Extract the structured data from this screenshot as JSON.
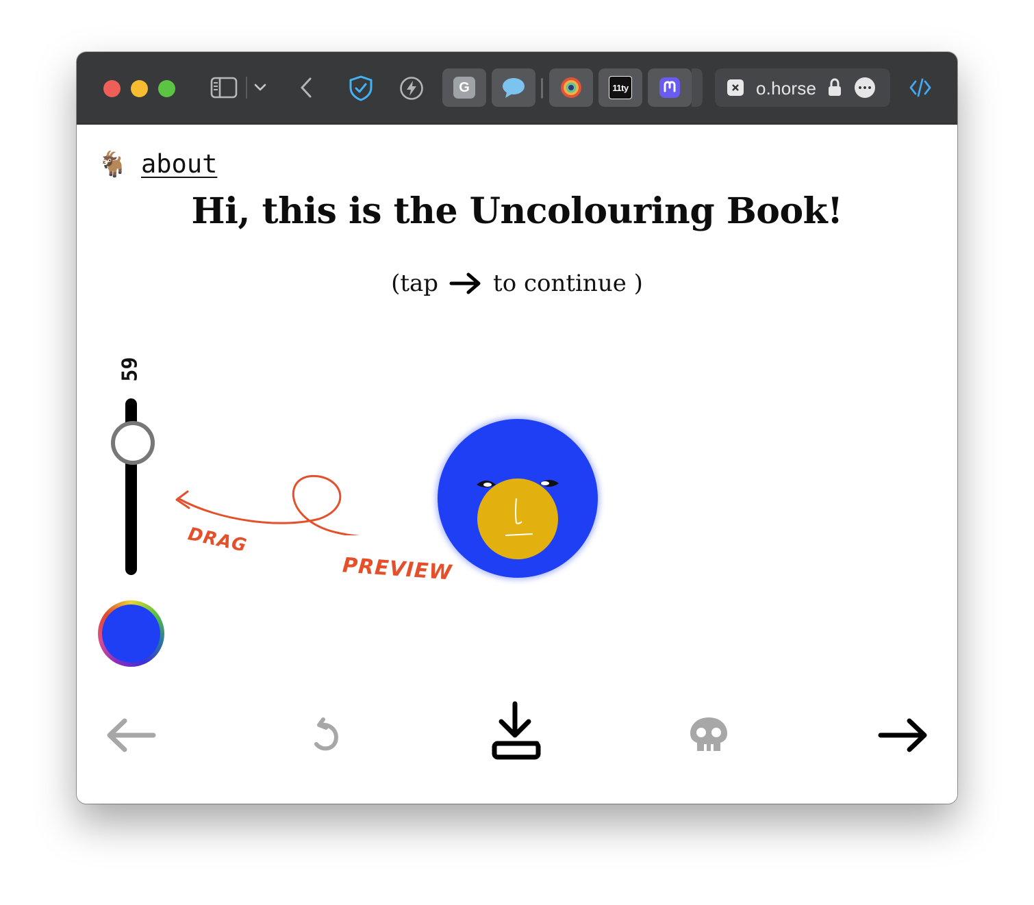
{
  "browser": {
    "url_text": "o.horse",
    "tabs": [
      {
        "name": "tab-g",
        "label": "G"
      },
      {
        "name": "tab-chat",
        "label": ""
      },
      {
        "name": "tab-circle",
        "label": ""
      },
      {
        "name": "tab-11ty",
        "label": "11ty"
      },
      {
        "name": "tab-mastodon",
        "label": ""
      }
    ],
    "icons": [
      "sidebar-icon",
      "chevron-down-icon",
      "back-icon",
      "shield-check-icon",
      "lightning-icon",
      "close-tab-icon",
      "lock-icon",
      "more-icon",
      "code-icon"
    ]
  },
  "page": {
    "logo_emoji": "🐐",
    "about_link": "about",
    "title": "Hi, this is the Uncolouring Book!",
    "hint_before": "(tap",
    "hint_after": "to continue )",
    "slider_value": "59",
    "annotation_drag": "DRAG",
    "annotation_preview": "PREVIEW",
    "color_hex": "#1f3ff5",
    "face_color": "#e2b10f"
  },
  "bottom_toolbar": {
    "buttons": [
      "back-arrow-icon",
      "undo-icon",
      "download-icon",
      "skull-icon",
      "next-arrow-icon"
    ]
  }
}
